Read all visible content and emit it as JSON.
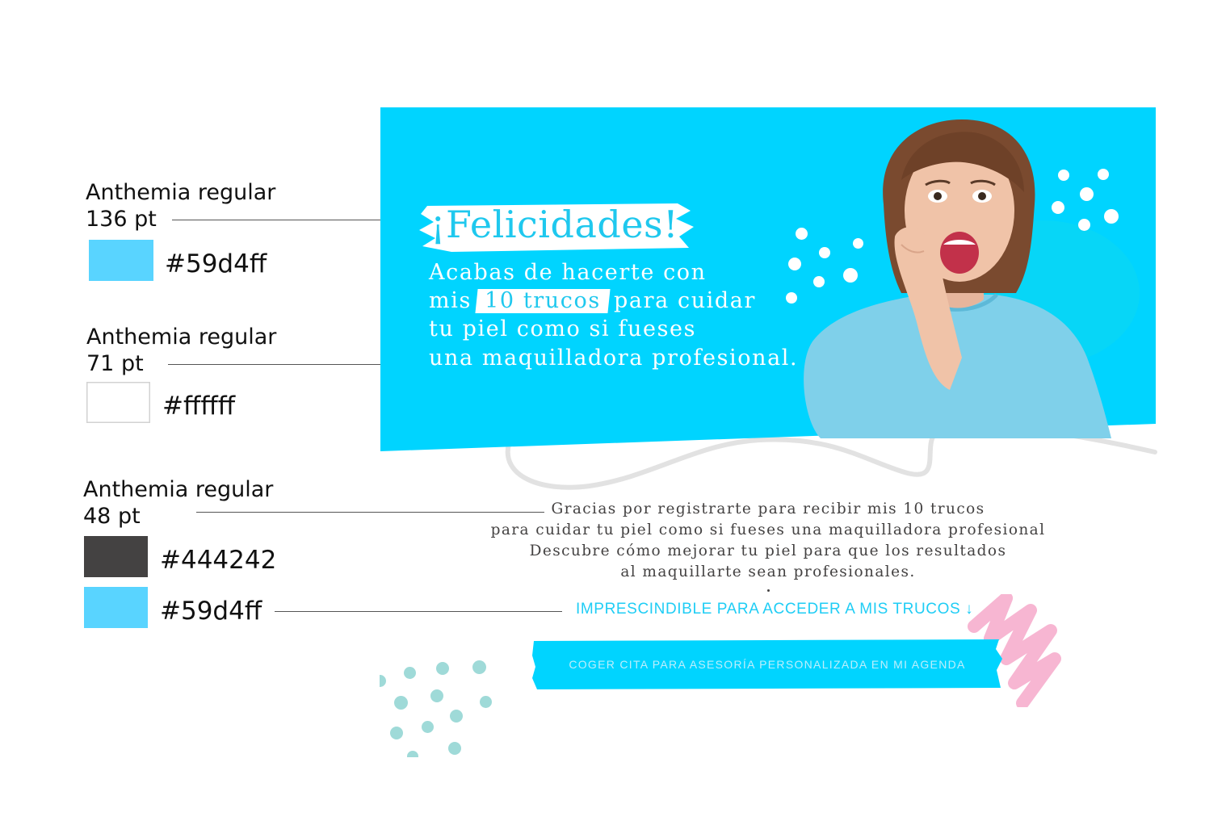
{
  "colors": {
    "brand_cyan": "#59d4ff",
    "white": "#ffffff",
    "text_dark": "#444242",
    "banner_bg": "#00d4ff",
    "accent_pink": "#f7b6d2",
    "accent_teal": "#9fdad8"
  },
  "specs": [
    {
      "label": "Anthemia regular\n136 pt",
      "hex": "#59d4ff",
      "color": "#59d4ff"
    },
    {
      "label": "Anthemia regular\n71 pt",
      "hex": "#ffffff",
      "color": "#ffffff"
    },
    {
      "label": "Anthemia regular\n48 pt",
      "hex": "#444242",
      "color": "#444242"
    },
    {
      "label": "",
      "hex": "#59d4ff",
      "color": "#59d4ff"
    }
  ],
  "banner": {
    "title": "¡Felicidades!",
    "subtitle": {
      "line1": "Acabas de hacerte con",
      "line2_before": "mis",
      "line2_highlight": "10 trucos",
      "line2_after": "para cuidar",
      "line3": "tu piel como si fueses",
      "line4": "una maquilladora profesional."
    },
    "image": "excited-woman-photo"
  },
  "content": {
    "body_lines": [
      "Gracias por registrarte para recibir mis 10 trucos",
      "para cuidar tu piel como si fueses una maquilladora profesional",
      "Descubre cómo mejorar tu piel para que los resultados",
      "al maquillarte sean profesionales."
    ],
    "cta_note": "IMPRESCINDIBLE PARA ACCEDER A MIS TRUCOS ↓",
    "cta_button": "COGER CITA PARA ASESORÍA PERSONALIZADA EN MI AGENDA"
  }
}
